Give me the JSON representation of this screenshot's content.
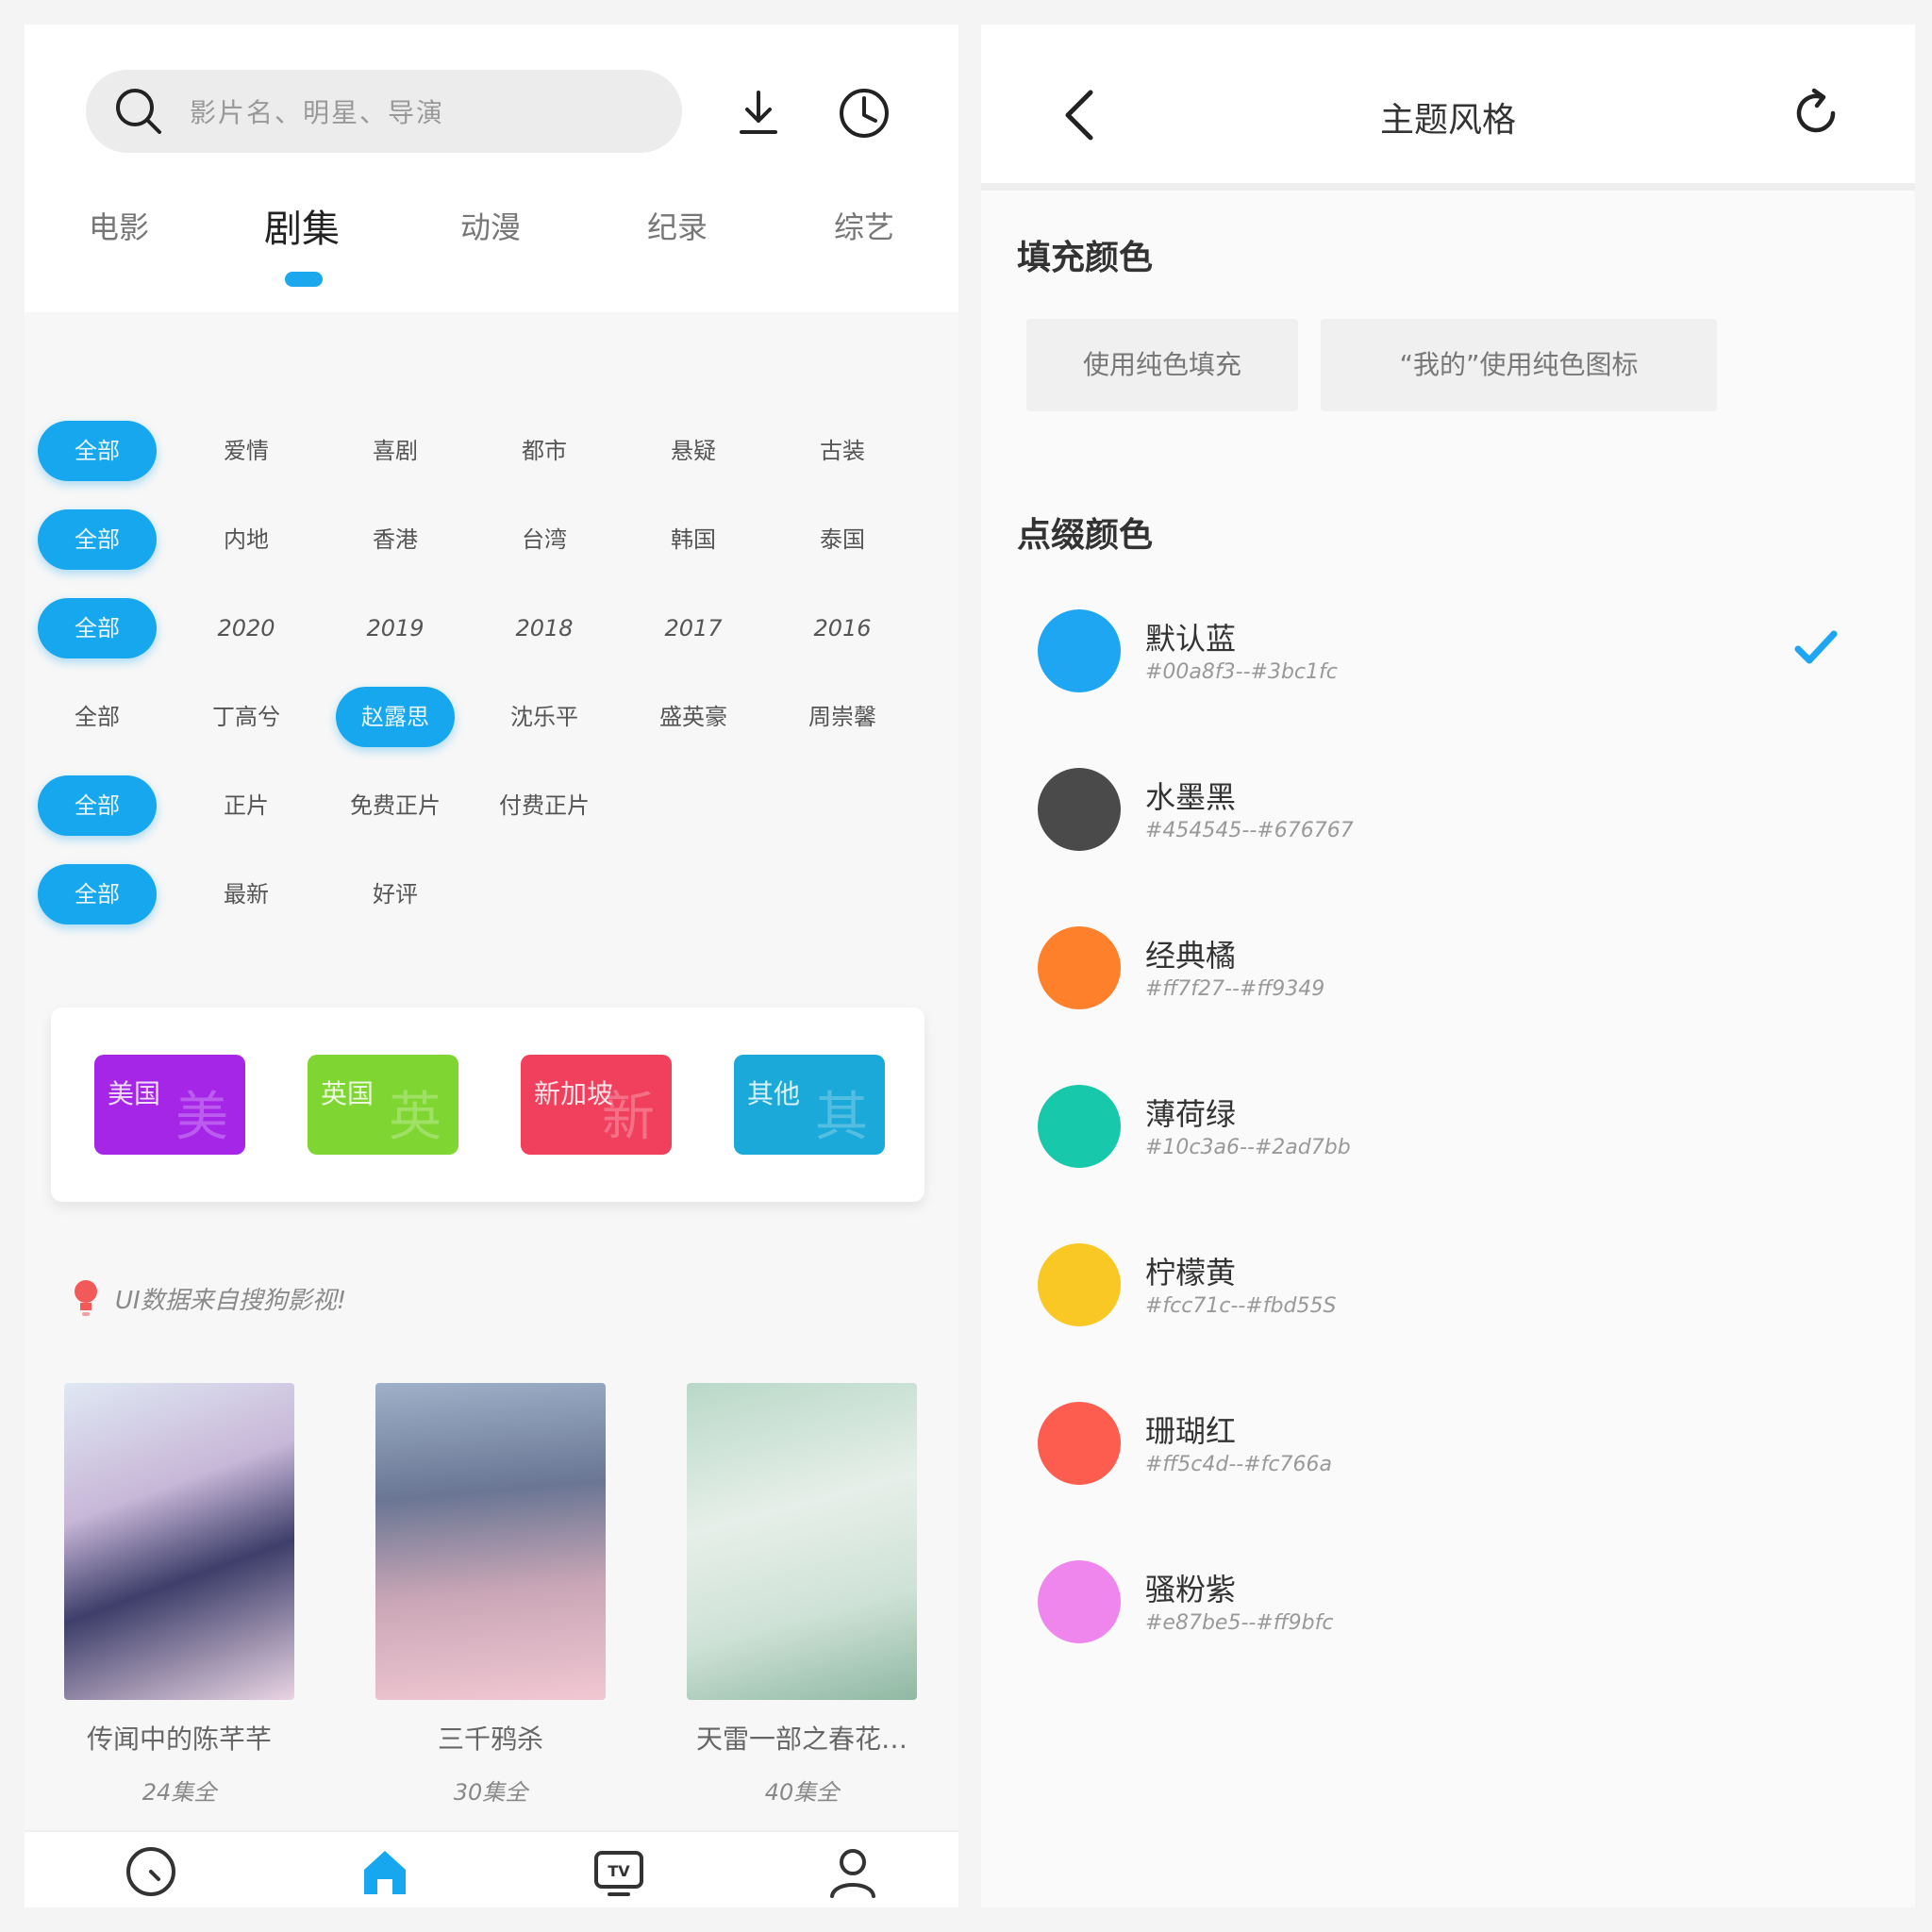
{
  "left": {
    "search": {
      "placeholder": "影片名、明星、导演"
    },
    "categories": [
      "电影",
      "剧集",
      "动漫",
      "纪录",
      "综艺"
    ],
    "filter_rows": [
      [
        "全部",
        "爱情",
        "喜剧",
        "都市",
        "悬疑",
        "古装"
      ],
      [
        "全部",
        "内地",
        "香港",
        "台湾",
        "韩国",
        "泰国"
      ],
      [
        "全部",
        "2020",
        "2019",
        "2018",
        "2017",
        "2016"
      ],
      [
        "全部",
        "丁高兮",
        "赵露思",
        "沈乐平",
        "盛英豪",
        "周崇馨"
      ],
      [
        "全部",
        "正片",
        "免费正片",
        "付费正片"
      ],
      [
        "全部",
        "最新",
        "好评"
      ]
    ],
    "regions": [
      {
        "name": "美国",
        "big": "美",
        "color": "#a626e8"
      },
      {
        "name": "英国",
        "big": "英",
        "color": "#7fd632"
      },
      {
        "name": "新加坡",
        "big": "新",
        "color": "#f0405e"
      },
      {
        "name": "其他",
        "big": "其",
        "color": "#1aa9d9"
      }
    ],
    "tip": "UI数据来自搜狗影视!",
    "posters": [
      {
        "title": "传闻中的陈芊芊",
        "count": "24集全"
      },
      {
        "title": "三千鸦杀",
        "count": "30集全"
      },
      {
        "title": "天雷一部之春花…",
        "count": "40集全"
      }
    ],
    "tabbar_icons": [
      "clock-icon",
      "home-icon",
      "tv-icon",
      "user-icon"
    ]
  },
  "right": {
    "title": "主题风格",
    "fill_section": "填充颜色",
    "fill_options": [
      "使用纯色填充",
      "“我的”使用纯色图标"
    ],
    "accent_section": "点缀颜色",
    "colors": [
      {
        "name": "默认蓝",
        "code": "#00a8f3--#3bc1fc",
        "color": "#1ea6f3",
        "selected": true
      },
      {
        "name": "水墨黑",
        "code": "#454545--#676767",
        "color": "#4a4a4a",
        "selected": false
      },
      {
        "name": "经典橘",
        "code": "#ff7f27--#ff9349",
        "color": "#ff802b",
        "selected": false
      },
      {
        "name": "薄荷绿",
        "code": "#10c3a6--#2ad7bb",
        "color": "#18c8aa",
        "selected": false
      },
      {
        "name": "柠檬黄",
        "code": "#fcc71c--#fbd55S",
        "color": "#f9c825",
        "selected": false
      },
      {
        "name": "珊瑚红",
        "code": "#ff5c4d--#fc766a",
        "color": "#fd5d4f",
        "selected": false
      },
      {
        "name": "骚粉紫",
        "code": "#e87be5--#ff9bfc",
        "color": "#ee86ee",
        "selected": false
      }
    ]
  }
}
